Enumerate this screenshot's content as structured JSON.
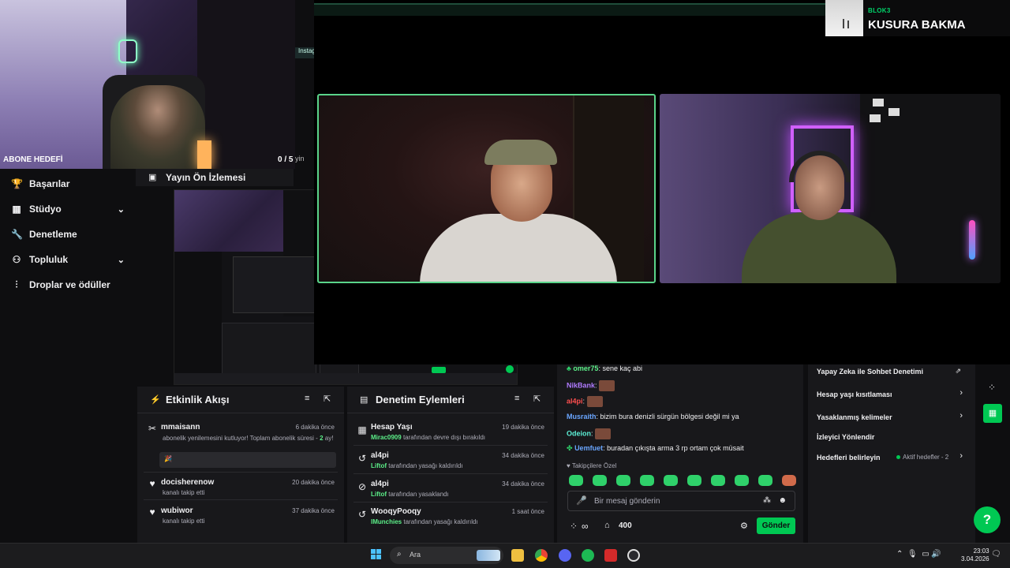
{
  "subgoal": {
    "label": "ABONE HEDEFİ",
    "value": "0 / 5"
  },
  "preview": {
    "title": "Yayın Ön İzlemesi",
    "tab_fragment": "Instag",
    "side_text": "yin"
  },
  "nav": {
    "items": [
      {
        "label": "Başarılar",
        "icon": "trophy-icon"
      },
      {
        "label": "Stüdyo",
        "icon": "studio-icon",
        "expandable": true
      },
      {
        "label": "Denetleme",
        "icon": "wrench-icon"
      },
      {
        "label": "Topluluk",
        "icon": "community-icon",
        "expandable": true
      },
      {
        "label": "Droplar ve ödüller",
        "icon": "drops-icon"
      }
    ]
  },
  "now_playing": {
    "artist": "BLOK3",
    "title": "KUSURA BAKMA"
  },
  "activity_feed": {
    "title": "Etkinlik Akışı",
    "events": [
      {
        "icon": "resub-icon",
        "name": "mmaisann",
        "time": "6 dakika önce",
        "desc": "abonelik yenilemesini kutluyor! Toplam abonelik süresi - 2 ay!",
        "highlight": "2"
      },
      {
        "icon": "heart-icon",
        "name": "docisherenow",
        "time": "20 dakika önce",
        "desc": "kanalı takip etti"
      },
      {
        "icon": "heart-icon",
        "name": "wubiwor",
        "time": "37 dakika önce",
        "desc": "kanalı takip etti"
      }
    ]
  },
  "mod_actions": {
    "title": "Denetim Eylemleri",
    "events": [
      {
        "icon": "calendar-icon",
        "name": "Hesap Yaşı",
        "time": "19 dakika önce",
        "actor": "Mirac0909",
        "desc": "tarafından devre dışı bırakıldı"
      },
      {
        "icon": "undo-icon",
        "name": "al4pi",
        "time": "34 dakika önce",
        "actor": "Liftof",
        "desc": "tarafından yasağı kaldırıldı"
      },
      {
        "icon": "ban-icon",
        "name": "al4pi",
        "time": "34 dakika önce",
        "actor": "Liftof",
        "desc": "tarafından yasaklandı"
      },
      {
        "icon": "undo-icon",
        "name": "WooqyPooqy",
        "time": "1 saat önce",
        "actor": "lMunchies",
        "desc": "tarafından yasağı kaldırıldı"
      }
    ]
  },
  "chat": {
    "messages": [
      {
        "user": "omer75",
        "color": "#5cf089",
        "text": ": sene kaç abi"
      },
      {
        "user": "NikBank",
        "color": "#b07bff",
        "text": ":",
        "emote": true
      },
      {
        "user": "al4pi",
        "color": "#ff4f4f",
        "text": ":",
        "emote": true
      },
      {
        "user": "Musraith",
        "color": "#6aa6ff",
        "text": ": bizim bura denizli sürgün bölgesi değil mi ya"
      },
      {
        "user": "Odeion",
        "color": "#5cf0d6",
        "text": ":",
        "emote": true
      },
      {
        "user": "Uemfuet",
        "color": "#6aa6ff",
        "text": ": buradan çıkışta arma 3 rp ortam çok müsait"
      }
    ],
    "follower_only": "Takipçilere Özel",
    "placeholder": "Bir mesaj gönderin",
    "points": "400",
    "send": "Gönder"
  },
  "mod_settings": {
    "items": [
      {
        "label": "Yapay Zeka ile Sohbet Denetimi",
        "kind": "external"
      },
      {
        "label": "Hesap yaşı kısıtlaması",
        "kind": "arrow"
      },
      {
        "label": "Yasaklanmış kelimeler",
        "kind": "arrow"
      },
      {
        "label": "İzleyici Yönlendir",
        "kind": "none"
      },
      {
        "label": "Hedefleri belirleyin",
        "kind": "arrow"
      }
    ],
    "active_goals": "Aktif hedefler - 2"
  },
  "taskbar": {
    "search_placeholder": "Ara",
    "time": "23:03",
    "date": "3.04.2026",
    "apps": [
      "file-explorer-icon",
      "chrome-icon",
      "discord-icon",
      "spotify-icon",
      "app-icon",
      "obs-icon"
    ]
  },
  "colors": {
    "accent": "#00c853",
    "panel": "#18181b",
    "bg": "#0e0e10"
  }
}
